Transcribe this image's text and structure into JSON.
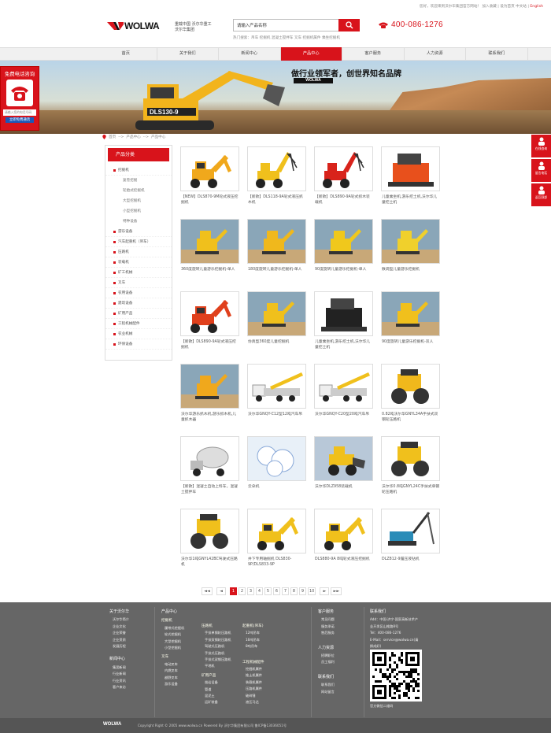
{
  "topbar": {
    "text": "您好，欢迎来到沃尔华集团官方网站！ 加入收藏 | 设为首页 中文站 |",
    "english": "English"
  },
  "logo": {
    "wordmark": "WOLWA"
  },
  "header_slogan": {
    "line1": "重载中国  沃尔华重工",
    "line2": "沃尔华集团"
  },
  "search": {
    "placeholder": "请输入产品名称"
  },
  "hot": {
    "text": "热门搜索：吊车  挖掘机  混凝土搅拌车  叉车  挖掘机属件  乘坐挖掘机"
  },
  "phone": {
    "number": "400-086-1276"
  },
  "nav": [
    "首页",
    "关于我们",
    "新闻中心",
    "产品中心",
    "客户服务",
    "人力资源",
    "联系我们"
  ],
  "nav_active": 3,
  "banner": {
    "slogan": "做行业领军者，创世界知名品牌",
    "brand": "WOLWA",
    "model": "DLS130-9"
  },
  "callbox": {
    "title": "免费电话咨询",
    "input_placeholder": "请输入您的电话号码",
    "button": "立即免费通话"
  },
  "right_float": [
    "在线咨询",
    "留言电话",
    "返回顶部"
  ],
  "breadcrumb": {
    "home": "首页",
    "sep": "-->",
    "p1": "产品中心",
    "p2": "产品中心"
  },
  "sidebar": {
    "title": "产品分类",
    "items": [
      {
        "label": "挖掘机",
        "sub": false
      },
      {
        "label": "复卷挖掘",
        "sub": true
      },
      {
        "label": "轮胎式挖掘机",
        "sub": true
      },
      {
        "label": "大型挖掘机",
        "sub": true
      },
      {
        "label": "小型挖掘机",
        "sub": true
      },
      {
        "label": "特种设备",
        "sub": true
      },
      {
        "label": "游乐设备",
        "sub": false
      },
      {
        "label": "汽车起重机（吊车）",
        "sub": false
      },
      {
        "label": "压路机",
        "sub": false
      },
      {
        "label": "装载机",
        "sub": false
      },
      {
        "label": "矿工机械",
        "sub": false
      },
      {
        "label": "叉车",
        "sub": false
      },
      {
        "label": "农用设备",
        "sub": false
      },
      {
        "label": "建筑设备",
        "sub": false
      },
      {
        "label": "矿用产品",
        "sub": false
      },
      {
        "label": "工程机械配件",
        "sub": false
      },
      {
        "label": "农业机械",
        "sub": false
      },
      {
        "label": "环保设备",
        "sub": false
      }
    ]
  },
  "products": [
    {
      "cap": "【NEW】DLS870-9M轮式液压挖掘机",
      "kind": "excavator",
      "color": "#f0a81c"
    },
    {
      "cap": "【新款】DLS118-9A轮式液压抓木机",
      "kind": "grabber",
      "color": "#f0c01c"
    },
    {
      "cap": "【新款】DLS890-9A轮式抓木装载机",
      "kind": "grabber",
      "color": "#d8231b"
    },
    {
      "cap": "儿童乘坐机,游乐挖土机,沃尔华儿童挖土机",
      "kind": "ride",
      "color": "#e8501c"
    },
    {
      "cap": "360度旋转儿童游乐挖掘机-单人",
      "kind": "kid",
      "color": "#f0c01c"
    },
    {
      "cap": "180度旋转儿童游乐挖掘机-单人",
      "kind": "kid",
      "color": "#f0b81c"
    },
    {
      "cap": "90度旋转儿童游乐挖掘机-单人",
      "kind": "kid",
      "color": "#f0c81c"
    },
    {
      "cap": "数调型儿童游乐挖掘机",
      "kind": "kid",
      "color": "#f0d02c"
    },
    {
      "cap": "【新款】DLS890-9A轮式液压挖掘机",
      "kind": "excavator",
      "color": "#e0401c"
    },
    {
      "cap": "仿真型360度儿童挖掘机",
      "kind": "kid",
      "color": "#f0c01c"
    },
    {
      "cap": "儿童乘坐机,游乐挖土机,沃尔华儿童挖土机",
      "kind": "ride",
      "color": "#222"
    },
    {
      "cap": "90度旋转儿童游乐挖掘机-双人",
      "kind": "kid",
      "color": "#f0c01c"
    },
    {
      "cap": "沃尔华游乐抓木机,游乐抓木机,儿童抓木器",
      "kind": "kid",
      "color": "#f0a81c"
    },
    {
      "cap": "沃尔华GNQY-C12型12吨汽车吊",
      "kind": "crane",
      "color": "#f0c01c"
    },
    {
      "cap": "沃尔华GNQY-C20型20吨汽车吊",
      "kind": "crane",
      "color": "#f0c01c"
    },
    {
      "cap": "0.82吨沃尔华GNYL34A手扶式双钢轮压路机",
      "kind": "roller",
      "color": "#f0b81c"
    },
    {
      "cap": "【新款】混凝土自动上料车，混凝土搅拌车",
      "kind": "mixer",
      "color": "#eee"
    },
    {
      "cap": "云朵机",
      "kind": "cloud",
      "color": "#88a8d8"
    },
    {
      "cap": "沃尔华DLZ958装载机",
      "kind": "loader",
      "color": "#f0c01c"
    },
    {
      "cap": "沃尔华0.8吨GNYL24C手扶式单钢轮压路机",
      "kind": "roller",
      "color": "#f0c01c"
    },
    {
      "cap": "沃尔华1吨GNYL42BC驾驶式压路机",
      "kind": "roller",
      "color": "#f0c01c"
    },
    {
      "cap": "井下专用轴掘机 DLS830-9P/DLS833-9P",
      "kind": "excavator",
      "color": "#f0c01c"
    },
    {
      "cap": "DLS880-9A 8吨轮式液压挖掘机",
      "kind": "excavator",
      "color": "#f0c01c"
    },
    {
      "cap": "DLZ812-9履压液钻机",
      "kind": "drill",
      "color": "#2a8cb8"
    }
  ],
  "pager": [
    "◄◄",
    "◄",
    "1",
    "2",
    "3",
    "4",
    "5",
    "6",
    "7",
    "8",
    "9",
    "10",
    "►",
    "►►"
  ],
  "pager_active": 2,
  "footer": {
    "about": {
      "title": "关于沃尔华",
      "items": [
        "沃尔华简介",
        "企业文化",
        "企业荣誉",
        "企业资质",
        "发展历程"
      ]
    },
    "news": {
      "title": "新闻中心",
      "items": [
        "集团新闻",
        "行业新闻",
        "行业资讯",
        "客户来访"
      ]
    },
    "products": {
      "title": "产品中心"
    },
    "col_a": {
      "title": "挖掘机",
      "items": [
        "履带式挖掘机",
        "轮式挖掘机",
        "大型挖掘机",
        "小型挖掘机"
      ],
      "title2": "叉车",
      "items2": [
        "电动叉车",
        "内燃叉车",
        "越野叉车",
        "游乐设备"
      ]
    },
    "col_b": {
      "title": "压路机",
      "items": [
        "手扶单钢轮压路机",
        "手扶双钢轮压路机",
        "驾驶式压路机",
        "手扶式压路机",
        "手扶式双钢压路机",
        "平地机"
      ],
      "title2": "矿用产品",
      "items2": [
        "凿岩设备",
        "管道",
        "混泥土",
        "运矿装备"
      ]
    },
    "col_c": {
      "title": "起重机(吊车)",
      "items": [
        "12吨吊车",
        "16吨吊车",
        "8吨吊车"
      ],
      "title2": "工程机械配件",
      "items2": [
        "挖掘机属件",
        "推土机属件",
        "装载机属件",
        "压路机属件",
        "破碎锤",
        "液压马达"
      ]
    },
    "service": {
      "title": "客户服务",
      "items": [
        "常见问题",
        "服务承诺",
        "售后服务"
      ],
      "title2": "人力资源",
      "items2": [
        "招聘职位",
        "员工福利"
      ],
      "title3": "联系我们",
      "items3": [
        "联系我们",
        "网站留言"
      ]
    },
    "contact": {
      "title": "联系我们",
      "lines": [
        "Add：中国·济宁·国家高新技术产",
        "业开发区山推路8号",
        "Tel：400-086-1276",
        "E-Mail：service@wolwa.cn(请",
        "换成好)"
      ],
      "qr_label": "官方微信二维码"
    }
  },
  "copyright": {
    "brand": "WOLWA",
    "text": "Copyright Right © 2005 www.wolwa.cn Powered By 沃尔华集团有限公司  鲁ICP备13036051号"
  },
  "colors": {
    "accent": "#d8131b",
    "footer": "#666666"
  }
}
